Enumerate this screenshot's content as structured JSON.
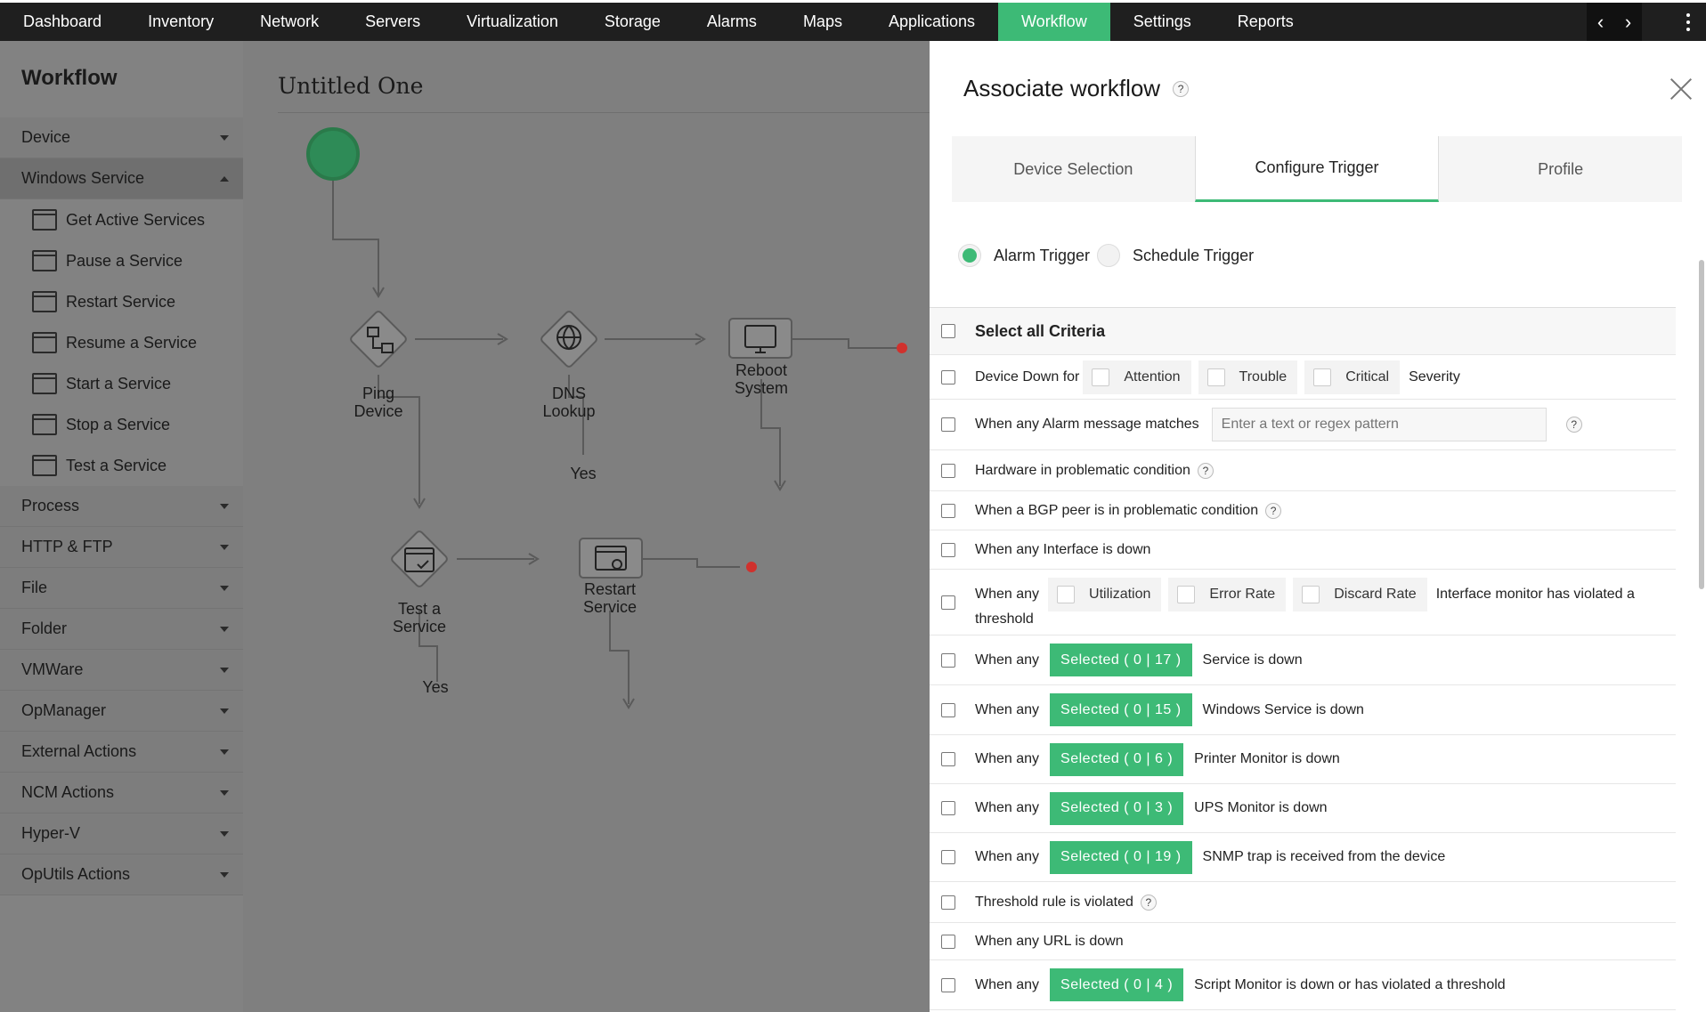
{
  "topnav": {
    "tabs": [
      "Dashboard",
      "Inventory",
      "Network",
      "Servers",
      "Virtualization",
      "Storage",
      "Alarms",
      "Maps",
      "Applications",
      "Workflow",
      "Settings",
      "Reports"
    ],
    "active": "Workflow"
  },
  "sidebar": {
    "title": "Workflow",
    "categories": {
      "device": "Device",
      "windows_service": "Windows Service",
      "process": "Process",
      "http_ftp": "HTTP & FTP",
      "file": "File",
      "folder": "Folder",
      "vmware": "VMWare",
      "opmanager": "OpManager",
      "external": "External Actions",
      "ncm": "NCM Actions",
      "hyperv": "Hyper-V",
      "oputils": "OpUtils Actions"
    },
    "windows_service_items": {
      "get_active": "Get Active Services",
      "pause": "Pause a Service",
      "restart": "Restart Service",
      "resume": "Resume a Service",
      "start": "Start a Service",
      "stop": "Stop a Service",
      "test": "Test a Service"
    }
  },
  "canvas": {
    "title": "Untitled One",
    "nodes": {
      "ping_l1": "Ping",
      "ping_l2": "Device",
      "dns_l1": "DNS",
      "dns_l2": "Lookup",
      "reboot_l1": "Reboot",
      "reboot_l2": "System",
      "test_l1": "Test a",
      "test_l2": "Service",
      "restart_l1": "Restart",
      "restart_l2": "Service"
    },
    "yes_label_1": "Yes",
    "yes_label_2": "Yes"
  },
  "panel": {
    "title": "Associate workflow",
    "help": "?",
    "tabs": {
      "device_selection": "Device Selection",
      "configure_trigger": "Configure Trigger",
      "profile": "Profile"
    },
    "triggers": {
      "alarm": "Alarm Trigger",
      "schedule": "Schedule Trigger",
      "selected": "alarm"
    },
    "criteria": {
      "select_all": "Select all Criteria",
      "device_down_for": "Device Down for",
      "attention": "Attention",
      "trouble": "Trouble",
      "critical": "Critical",
      "severity": "Severity",
      "alarm_message": "When any Alarm message matches",
      "regex_placeholder": "Enter a text or regex pattern",
      "hardware": "Hardware in problematic condition",
      "bgp": "When a BGP peer is in problematic condition",
      "interface_down": "When any Interface is down",
      "when_any": "When any",
      "utilization": "Utilization",
      "error_rate": "Error Rate",
      "discard_rate": "Discard Rate",
      "interface_monitor": "Interface monitor has violated a",
      "threshold_word": "threshold",
      "service_sel": "Selected ( 0 | 17 )",
      "service_down": "Service is down",
      "winservice_sel": "Selected ( 0 | 15 )",
      "winservice_down": "Windows Service is down",
      "printer_sel": "Selected ( 0 | 6 )",
      "printer_down": "Printer Monitor is down",
      "ups_sel": "Selected ( 0 | 3 )",
      "ups_down": "UPS Monitor is down",
      "snmp_sel": "Selected ( 0 | 19 )",
      "snmp_received": "SNMP trap is received from the device",
      "threshold_rule": "Threshold rule is violated",
      "url_down": "When any URL is down",
      "script_sel": "Selected ( 0 | 4 )",
      "script_down": "Script Monitor is down or has violated a threshold"
    }
  },
  "colors": {
    "accent": "#3dba76",
    "nav_bg": "#1f1f1f",
    "end_dot": "#d0312d"
  }
}
